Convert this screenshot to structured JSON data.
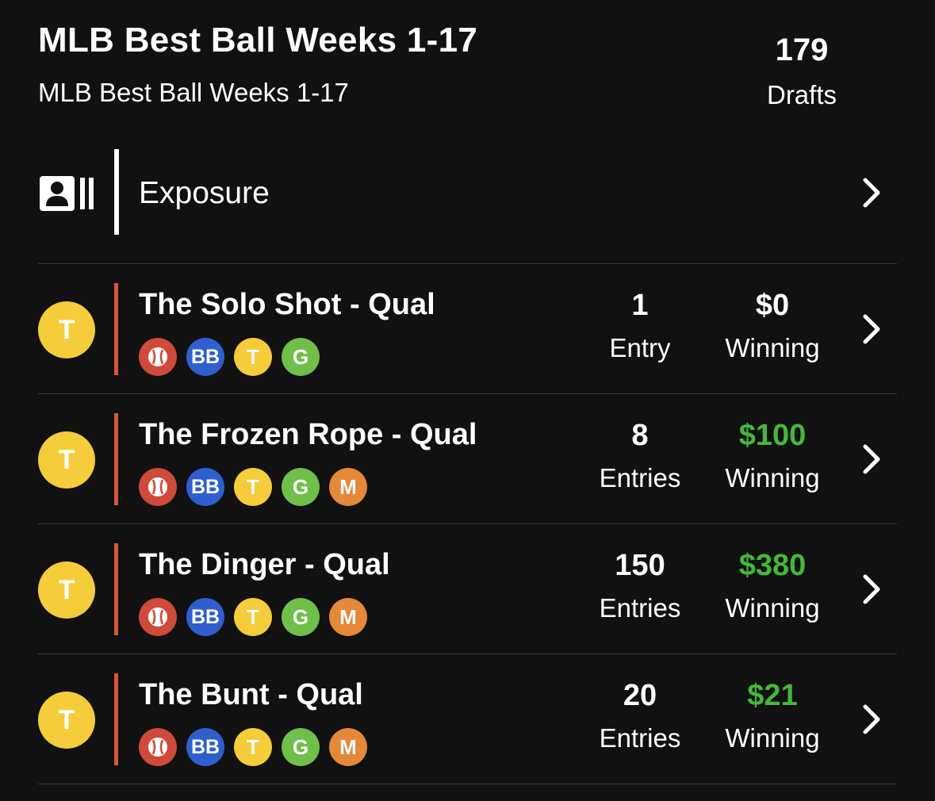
{
  "header": {
    "title": "MLB Best Ball Weeks 1-17",
    "subtitle": "MLB Best Ball Weeks 1-17",
    "drafts_count": "179",
    "drafts_label": "Drafts"
  },
  "exposure": {
    "icon": "roster-id-card-icon",
    "label": "Exposure"
  },
  "colors": {
    "background": "#111111",
    "accent_divider": "#d9553a",
    "winning_positive": "#45b83a",
    "avatar": "#f5cc3a"
  },
  "contests": [
    {
      "avatar_letter": "T",
      "name": "The Solo Shot - Qual",
      "badges": [
        "baseball-icon",
        "BB",
        "T",
        "G"
      ],
      "entries_value": "1",
      "entries_label": "Entry",
      "winning_value": "$0",
      "winning_label": "Winning"
    },
    {
      "avatar_letter": "T",
      "name": "The Frozen Rope - Qual",
      "badges": [
        "baseball-icon",
        "BB",
        "T",
        "G",
        "M"
      ],
      "entries_value": "8",
      "entries_label": "Entries",
      "winning_value": "$100",
      "winning_label": "Winning"
    },
    {
      "avatar_letter": "T",
      "name": "The Dinger - Qual",
      "badges": [
        "baseball-icon",
        "BB",
        "T",
        "G",
        "M"
      ],
      "entries_value": "150",
      "entries_label": "Entries",
      "winning_value": "$380",
      "winning_label": "Winning"
    },
    {
      "avatar_letter": "T",
      "name": "The Bunt - Qual",
      "badges": [
        "baseball-icon",
        "BB",
        "T",
        "G",
        "M"
      ],
      "entries_value": "20",
      "entries_label": "Entries",
      "winning_value": "$21",
      "winning_label": "Winning"
    }
  ]
}
